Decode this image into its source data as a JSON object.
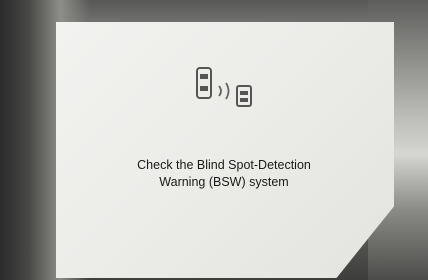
{
  "warning": {
    "icon": "blind-spot-warning-icon",
    "message_line1": "Check the Blind Spot-Detection",
    "message_line2": "Warning (BSW) system"
  },
  "colors": {
    "panel": "#ecece9",
    "text": "#1a1a1a"
  }
}
